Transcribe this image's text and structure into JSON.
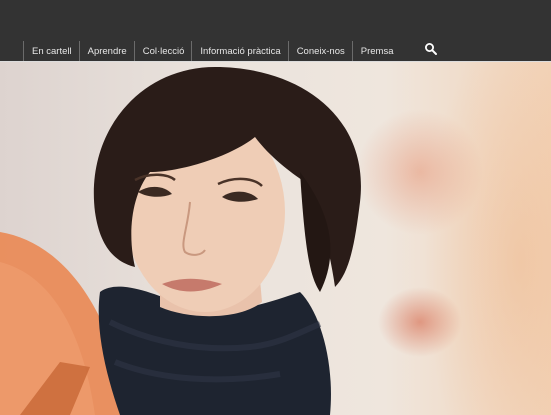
{
  "nav": {
    "items": [
      {
        "label": "En cartell"
      },
      {
        "label": "Aprendre"
      },
      {
        "label": "Col·lecció"
      },
      {
        "label": "Informació pràctica"
      },
      {
        "label": "Coneix-nos"
      },
      {
        "label": "Premsa"
      }
    ],
    "search_icon": "search-icon"
  },
  "colors": {
    "topbar": "#333333",
    "nav_text": "#e6e6e6",
    "accent_orange": "#e98a56"
  },
  "hero": {
    "subject": "hero-portrait-image"
  }
}
